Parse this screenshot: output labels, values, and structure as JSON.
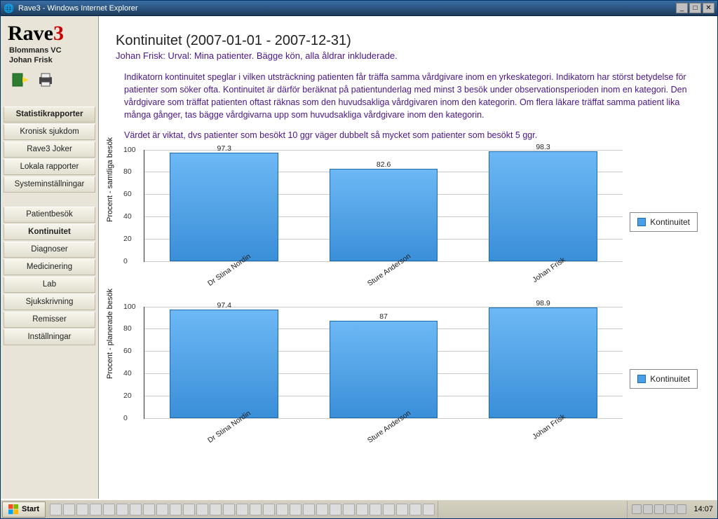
{
  "window": {
    "title": "Rave3 - Windows Internet Explorer"
  },
  "brand": {
    "name": "Rave",
    "suffix": "3",
    "org": "Blommans VC",
    "user": "Johan Frisk"
  },
  "nav": {
    "group1_header": "Statistikrapporter",
    "group1": [
      "Kronisk sjukdom",
      "Rave3 Joker",
      "Lokala rapporter",
      "Systeminställningar"
    ],
    "group2": [
      "Patientbesök",
      "Kontinuitet",
      "Diagnoser",
      "Medicinering",
      "Lab",
      "Sjukskrivning",
      "Remisser",
      "Inställningar"
    ],
    "active": "Kontinuitet"
  },
  "page": {
    "title": "Kontinuitet (2007-01-01 - 2007-12-31)",
    "subtitle": "Johan Frisk: Urval: Mina patienter. Bägge kön, alla åldrar inkluderade.",
    "para1": "Indikatorn kontinuitet speglar i vilken utsträckning patienten får träffa samma vårdgivare inom en yrkeskategori. Indikatorn har störst betydelse för patienter som söker ofta. Kontinuitet är därför beräknat på patientunderlag med minst 3 besök under observationsperioden inom en kategori. Den vårdgivare som träffat patienten oftast räknas som den huvudsakliga vårdgivaren inom den kategorin. Om flera läkare träffat samma patient lika många gånger, tas bägge vårdgivarna upp som huvudsakliga vårdgivare inom den kategorin.",
    "para2": "Värdet är viktat, dvs patienter som besökt 10 ggr väger dubbelt så mycket som patienter som besökt 5 ggr.",
    "legend": "Kontinuitet"
  },
  "chart_data": [
    {
      "type": "bar",
      "ylabel": "Procent - samtliga besök",
      "ylim": [
        0,
        100
      ],
      "yticks": [
        0,
        20,
        40,
        60,
        80,
        100
      ],
      "categories": [
        "Dr Stina Nordin",
        "Sture Anderson",
        "Johan Frisk"
      ],
      "series": [
        {
          "name": "Kontinuitet",
          "values": [
            97.3,
            82.6,
            98.3
          ]
        }
      ]
    },
    {
      "type": "bar",
      "ylabel": "Procent - planerade besök",
      "ylim": [
        0,
        100
      ],
      "yticks": [
        0,
        20,
        40,
        60,
        80,
        100
      ],
      "categories": [
        "Dr Stina Nordin",
        "Sture Anderson",
        "Johan Frisk"
      ],
      "series": [
        {
          "name": "Kontinuitet",
          "values": [
            97.4,
            87,
            98.9
          ]
        }
      ]
    }
  ],
  "taskbar": {
    "start": "Start",
    "clock": "14:07"
  }
}
